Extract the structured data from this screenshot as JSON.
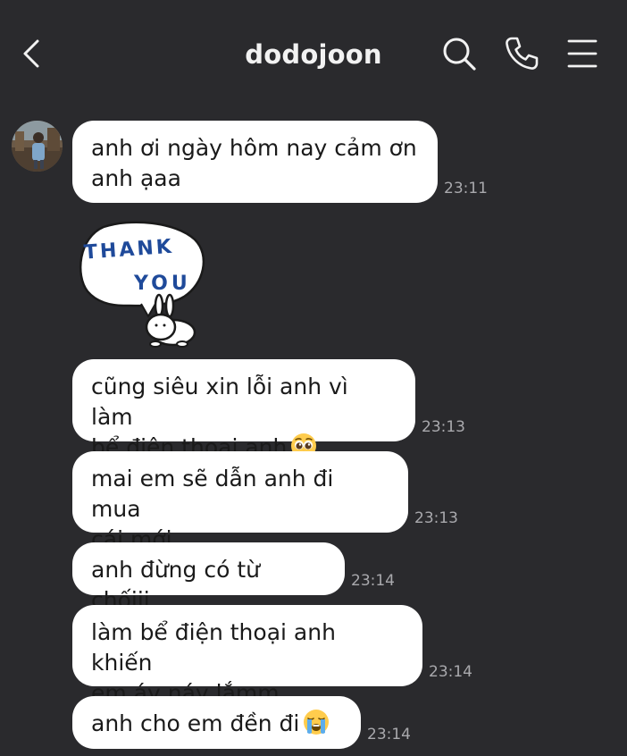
{
  "header": {
    "contact_name": "dodojoon",
    "back_icon": "chevron-left-icon",
    "search_icon": "search-icon",
    "call_icon": "phone-icon",
    "menu_icon": "menu-icon"
  },
  "messages": [
    {
      "type": "text",
      "lines": [
        "anh ơi ngày hôm nay cảm ơn",
        "anh ạaa"
      ],
      "time": "23:11"
    },
    {
      "type": "sticker",
      "sticker_text": [
        "THANK",
        "YOU"
      ]
    },
    {
      "type": "text",
      "lines": [
        "cũng siêu xin lỗi anh vì làm",
        "bể điện thoại anh"
      ],
      "emoji": "pleading-face-emoji",
      "time": "23:13"
    },
    {
      "type": "text",
      "lines": [
        "mai em sẽ dẫn anh đi mua",
        "cái mới"
      ],
      "time": "23:13"
    },
    {
      "type": "text",
      "lines": [
        "anh đừng có từ chốiii"
      ],
      "time": "23:14"
    },
    {
      "type": "text",
      "lines": [
        "làm bể điện thoại anh khiến",
        "em áy náy lắmm"
      ],
      "time": "23:14"
    },
    {
      "type": "text",
      "lines": [
        "anh cho em đền đi"
      ],
      "emoji": "loudly-crying-face-emoji",
      "time": "23:14"
    }
  ],
  "colors": {
    "background": "#2a2a2d",
    "bubble": "#ffffff",
    "bubble_text": "#1a1a1a",
    "timestamp": "#a9a9ad",
    "header_text": "#f2f2f2"
  }
}
